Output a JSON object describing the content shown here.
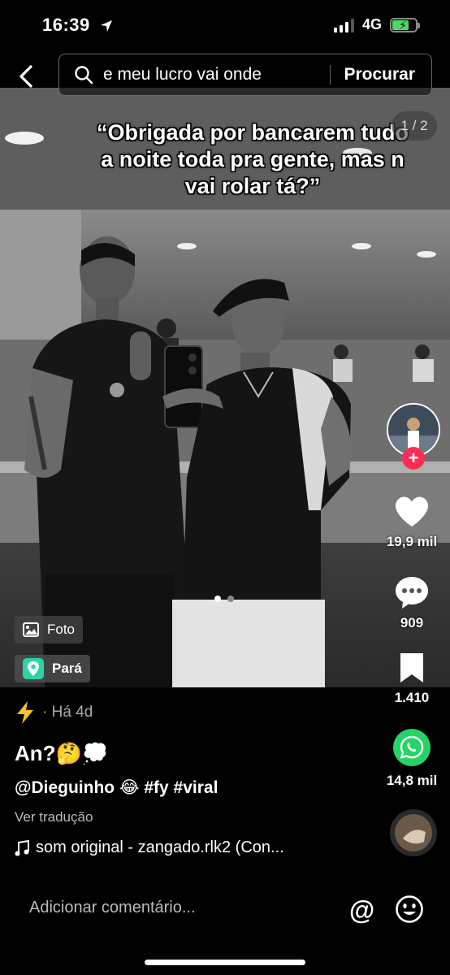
{
  "status": {
    "time": "16:39",
    "network": "4G"
  },
  "search": {
    "query": "e meu lucro vai onde",
    "submit_label": "Procurar"
  },
  "post": {
    "caption_text": "“Obrigada por bancarem tudo a noite toda pra gente, mas n vai rolar tá?”",
    "page_counter": "1 / 2",
    "photo_tag": "Foto",
    "location_tag": "Pará",
    "posted_ago": "· Há 4d",
    "title": "An?🤔💭",
    "description": "@Dieguinho 😂 #fy #viral",
    "translate_label": "Ver tradução",
    "music": "som original - zangado.rlk2 (Con..."
  },
  "actions": {
    "likes": "19,9 mil",
    "comments": "909",
    "saves": "1.410",
    "shares": "14,8 mil"
  },
  "comment_bar": {
    "placeholder": "Adicionar comentário..."
  },
  "icons": {
    "back": "back-chevron-icon",
    "search": "search-icon",
    "like": "heart-icon",
    "comment": "comment-bubble-icon",
    "save": "bookmark-icon",
    "share": "whatsapp-icon",
    "location": "location-pin-icon",
    "photo": "photo-icon",
    "mention": "at-icon",
    "emoji": "emoji-icon",
    "lightning": "lightning-icon"
  },
  "colors": {
    "follow_plus": "#fe2c55",
    "whatsapp": "#25d366",
    "location": "#2bd4a4",
    "battery": "#4cd964"
  }
}
